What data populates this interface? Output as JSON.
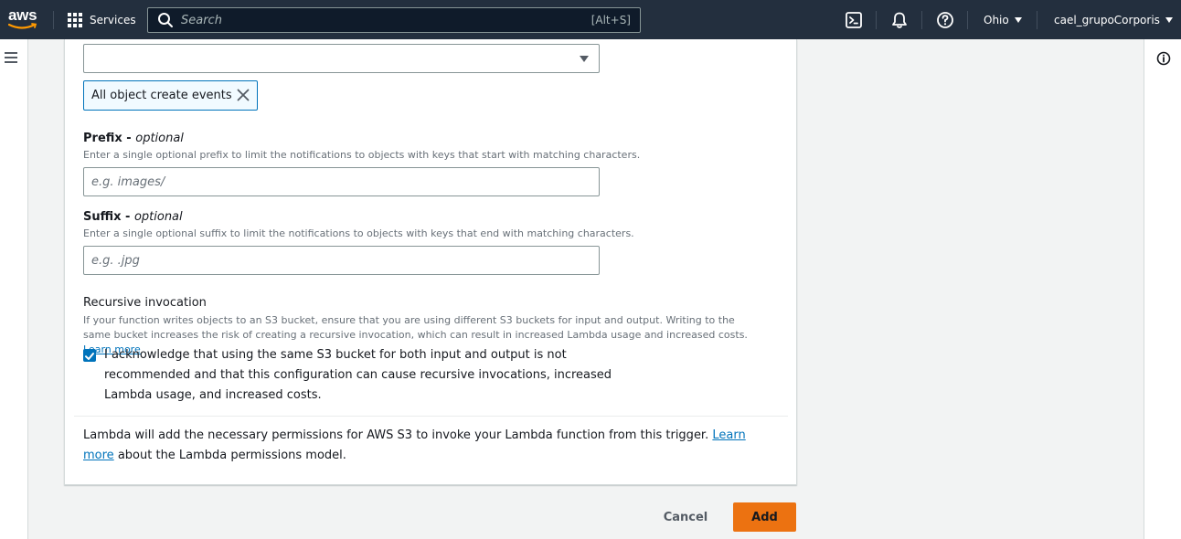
{
  "topnav": {
    "logo_text": "aws",
    "services_label": "Services",
    "search_placeholder": "Search",
    "search_shortcut": "[Alt+S]",
    "region": "Ohio",
    "account": "cael_grupoCorporis",
    "icons": [
      "cloudshell-icon",
      "bell-icon",
      "help-icon"
    ]
  },
  "form": {
    "selected_event_token": "All object create events",
    "prefix": {
      "label": "Prefix - ",
      "label_optional": "optional",
      "description": "Enter a single optional prefix to limit the notifications to objects with keys that start with matching characters.",
      "placeholder": "e.g. images/"
    },
    "suffix": {
      "label": "Suffix - ",
      "label_optional": "optional",
      "description": "Enter a single optional suffix to limit the notifications to objects with keys that end with matching characters.",
      "placeholder": "e.g. .jpg"
    },
    "recursive": {
      "heading": "Recursive invocation",
      "description": "If your function writes objects to an S3 bucket, ensure that you are using different S3 buckets for input and output. Writing to the same bucket increases the risk of creating a recursive invocation, which can result in increased Lambda usage and increased costs.",
      "learn_more": "Learn more",
      "ack_checked": true,
      "ack_text": "I acknowledge that using the same S3 bucket for both input and output is not recommended and that this configuration can cause recursive invocations, increased Lambda usage, and increased costs."
    },
    "permissions": {
      "text": "Lambda will add the necessary permissions for AWS S3 to invoke your Lambda function from this trigger.",
      "learn_more": "Learn more",
      "suffix_text": "about the Lambda permissions model."
    }
  },
  "footer": {
    "cancel_label": "Cancel",
    "add_label": "Add"
  },
  "colors": {
    "nav_bg": "#232f3e",
    "primary_button": "#ec7211",
    "link": "#0073bb"
  }
}
